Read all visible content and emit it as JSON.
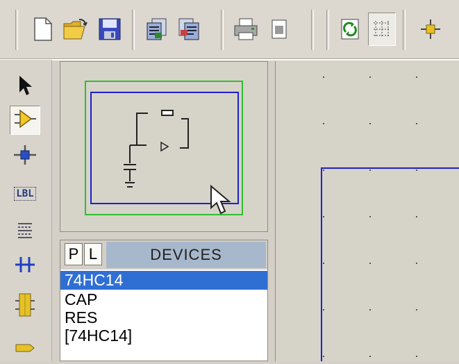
{
  "toolbar": {
    "icons": [
      "new-file-icon",
      "open-folder-icon",
      "save-icon",
      "import-section-icon",
      "export-section-icon",
      "print-icon",
      "set-area-icon",
      "refresh-icon",
      "grid-toggle-icon",
      "origin-icon"
    ]
  },
  "left_tools": {
    "icons": [
      "selection-mode-icon",
      "component-mode-icon",
      "junction-dot-mode-icon",
      "wire-label-mode-icon",
      "text-script-mode-icon",
      "buses-mode-icon",
      "subcircuit-mode-icon",
      "terminals-mode-icon"
    ],
    "wire_label_text": "LBL"
  },
  "devices_panel": {
    "pick_button_label": "P",
    "library_button_label": "L",
    "title": "DEVICES",
    "items": [
      "74HC14",
      "CAP",
      "RES",
      "[74HC14]"
    ],
    "selected_index": 0
  },
  "colors": {
    "selection": "#2f6fd4",
    "sheet_border": "#1f1fc8",
    "view_area": "#2fbf2f",
    "devices_header": "#a8b8cc"
  }
}
